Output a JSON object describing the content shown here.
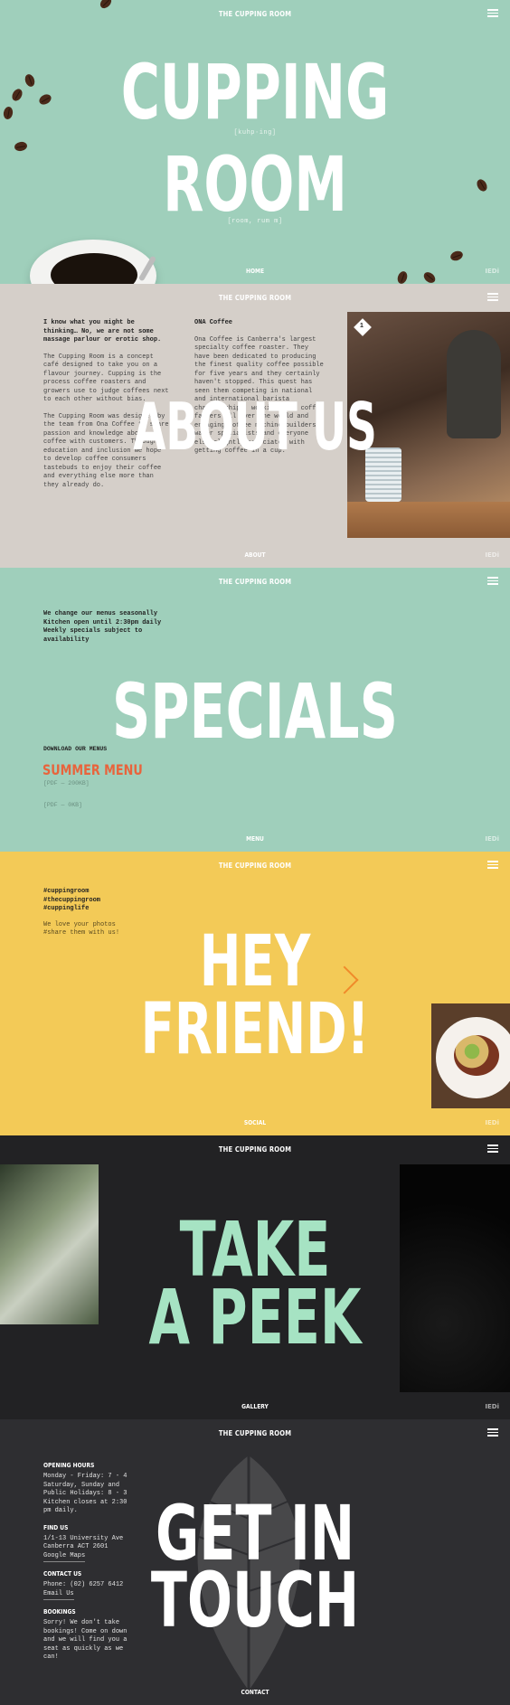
{
  "brand": "THE CUPPING ROOM",
  "colors": {
    "mint": "#9fcfbb",
    "stone": "#d5cfc9",
    "mustard": "#f3ca57",
    "charcoal": "#222224",
    "slate": "#2e2e31",
    "accent_orange": "#e8643c",
    "gallery_mint": "#a6e3c3"
  },
  "home": {
    "title_line1": "CUPPING",
    "pron1": "[kuhp·ing]",
    "title_line2": "ROOM",
    "pron2": "[room, rum m]",
    "label": "HOME",
    "mark": "IEDi"
  },
  "about": {
    "col1_heading": "I know what you might be thinking… No, we are not some massage parlour or erotic shop.",
    "col1_p1": "The Cupping Room is a concept café designed to take you on a flavour journey. Cupping is the process coffee roasters and growers use to judge coffees next to each other without bias.",
    "col1_p2": "The Cupping Room was designed by the team from Ona Coffee to share passion and knowledge about coffee with customers. Through education and inclusion we hope to develop coffee consumers tastebuds to enjoy their coffee and everything else more than they already do.",
    "col2_heading": "ONA Coffee",
    "col2_p1": "Ona Coffee is Canberra's largest specialty coffee roaster. They have been dedicated to producing the finest quality coffee possible for five years and they certainly haven't stopped. This quest has seen them competing in national and international barista championships, working with coffee farmers all over the world and engaging coffee machine builders, water specialists and everyone else slightly associated with getting coffee in a cup.",
    "badge": "1",
    "title": "ABOUT US",
    "label": "ABOUT",
    "mark": "IEDi"
  },
  "menu": {
    "notes": "We change our menus seasonally Kitchen open until 2:30pm daily Weekly specials subject to availability",
    "title": "SPECIALS",
    "download": "DOWNLOAD OUR MENUS",
    "summer": "SUMMER MENU",
    "pdf1": "[PDF — 200KB]",
    "pdf2": "[PDF — 0KB]",
    "label": "MENU",
    "mark": "IEDi"
  },
  "social": {
    "tags": "#cuppingroom\n#thecuppingroom\n#cuppinglife",
    "note": "We love your photos\n#share them with us!",
    "title_line1": "HEY",
    "title_line2": "FRIEND!",
    "label": "SOCIAL",
    "mark": "IEDi"
  },
  "gallery": {
    "title_line1": "TAKE",
    "title_line2": "A PEEK",
    "label": "GALLERY",
    "mark": "IEDi"
  },
  "contact": {
    "hours_heading": "OPENING HOURS",
    "hours_text": "Monday - Friday: 7 - 4 Saturday, Sunday and Public Holidays: 8 - 3 Kitchen closes at 2:30 pm daily.",
    "find_heading": "FIND US",
    "find_text": "1/1-13 University Ave Canberra ACT 2601",
    "maps_link": "Google Maps",
    "contact_heading": "CONTACT US",
    "phone": "Phone: (02) 6257 6412",
    "email_link": "Email Us",
    "bookings_heading": "BOOKINGS",
    "bookings_text": "Sorry! We don't take bookings! Come on down and we will find you a seat as quickly as we can!",
    "title_line1": "GET IN",
    "title_line2": "TOUCH",
    "label": "CONTACT"
  }
}
